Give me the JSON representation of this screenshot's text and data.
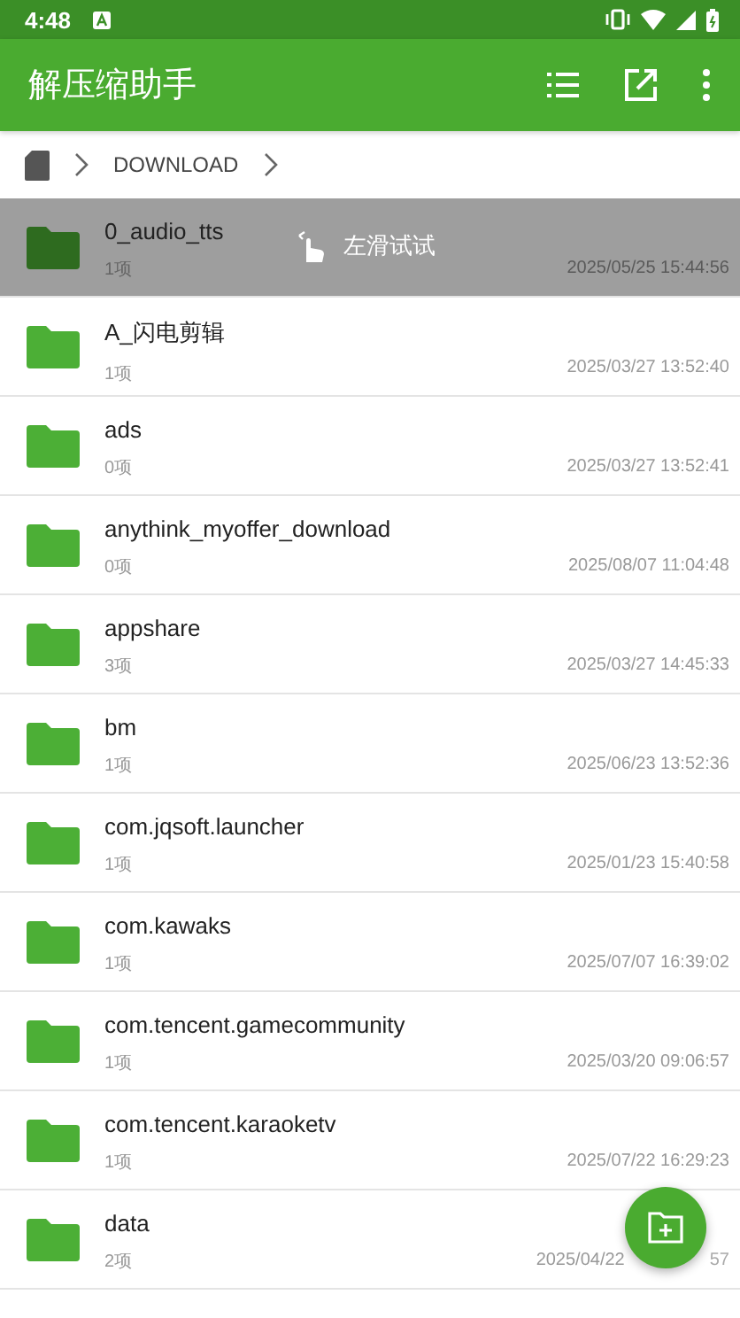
{
  "status_bar": {
    "time": "4:48"
  },
  "app_bar": {
    "title": "解压缩助手"
  },
  "breadcrumb": {
    "items": [
      "DOWNLOAD"
    ]
  },
  "files": [
    {
      "name": "0_audio_tts",
      "count": "1项",
      "date": "2025/05/25 15:44:56",
      "selected": true,
      "hint": "左滑试试"
    },
    {
      "name": "A_闪电剪辑",
      "count": "1项",
      "date": "2025/03/27 13:52:40",
      "selected": false
    },
    {
      "name": "ads",
      "count": "0项",
      "date": "2025/03/27 13:52:41",
      "selected": false
    },
    {
      "name": "anythink_myoffer_download",
      "count": "0项",
      "date": "2025/08/07 11:04:48",
      "selected": false
    },
    {
      "name": "appshare",
      "count": "3项",
      "date": "2025/03/27 14:45:33",
      "selected": false
    },
    {
      "name": "bm",
      "count": "1项",
      "date": "2025/06/23 13:52:36",
      "selected": false
    },
    {
      "name": "com.jqsoft.launcher",
      "count": "1项",
      "date": "2025/01/23 15:40:58",
      "selected": false
    },
    {
      "name": "com.kawaks",
      "count": "1项",
      "date": "2025/07/07 16:39:02",
      "selected": false
    },
    {
      "name": "com.tencent.gamecommunity",
      "count": "1项",
      "date": "2025/03/20 09:06:57",
      "selected": false
    },
    {
      "name": "com.tencent.karaoketv",
      "count": "1项",
      "date": "2025/07/22 16:29:23",
      "selected": false
    },
    {
      "name": "data",
      "count": "2项",
      "date": "2025/04/22",
      "date_tail": "57",
      "selected": false
    }
  ]
}
